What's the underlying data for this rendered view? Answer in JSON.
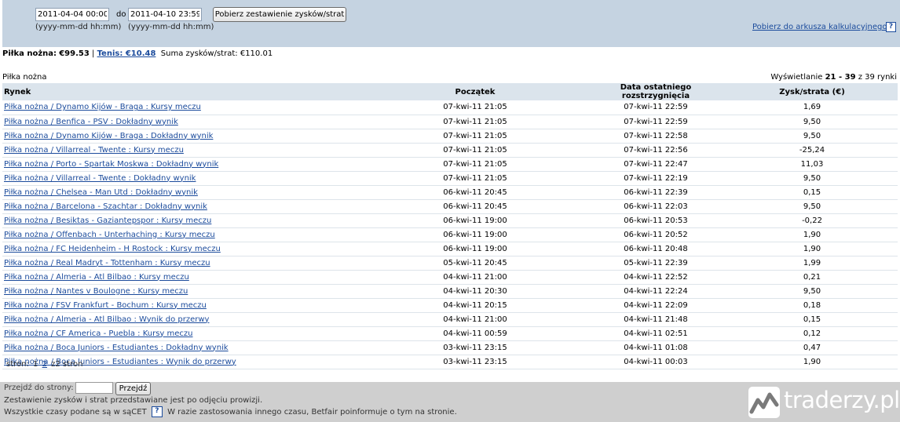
{
  "filter": {
    "date_from": "2011-04-04 00:00",
    "date_to": "2011-04-10 23:59",
    "separator": "do",
    "format_hint": "(yyyy-mm-dd hh:mm)",
    "get_summary_label": "Pobierz zestawienie zysków/strat",
    "spreadsheet_link": "Pobierz do arkusza kalkulacyjnego",
    "help_glyph": "?"
  },
  "totals": {
    "football_label": "Piłka nożna:",
    "football_value": "€99.53",
    "divider": "|",
    "tennis_label": "Tenis: €10.48",
    "sum_label": "Suma zysków/strat:",
    "sum_value": "€110.01"
  },
  "section": {
    "title": "Piłka nożna",
    "paging_prefix": "Wyświetlanie",
    "paging_range": "21 - 39",
    "paging_suffix": "z 39 rynki"
  },
  "table": {
    "headers": {
      "market": "Rynek",
      "start": "Początek",
      "settled": "Data ostatniego rozstrzygnięcia",
      "pl": "Zysk/strata (€)"
    },
    "rows": [
      {
        "market": "Piłka nożna / Dynamo Kijów - Braga : Kursy meczu",
        "start": "07-kwi-11 21:05",
        "settled": "07-kwi-11 22:59",
        "pl": "1,69"
      },
      {
        "market": "Piłka nożna / Benfica - PSV : Dokładny wynik",
        "start": "07-kwi-11 21:05",
        "settled": "07-kwi-11 22:59",
        "pl": "9,50"
      },
      {
        "market": "Piłka nożna / Dynamo Kijów - Braga : Dokładny wynik",
        "start": "07-kwi-11 21:05",
        "settled": "07-kwi-11 22:58",
        "pl": "9,50"
      },
      {
        "market": "Piłka nożna / Villarreal - Twente : Kursy meczu",
        "start": "07-kwi-11 21:05",
        "settled": "07-kwi-11 22:56",
        "pl": "-25,24"
      },
      {
        "market": "Piłka nożna / Porto - Spartak Moskwa : Dokładny wynik",
        "start": "07-kwi-11 21:05",
        "settled": "07-kwi-11 22:47",
        "pl": "11,03"
      },
      {
        "market": "Piłka nożna / Villarreal - Twente : Dokładny wynik",
        "start": "07-kwi-11 21:05",
        "settled": "07-kwi-11 22:19",
        "pl": "9,50"
      },
      {
        "market": "Piłka nożna / Chelsea - Man Utd : Dokładny wynik",
        "start": "06-kwi-11 20:45",
        "settled": "06-kwi-11 22:39",
        "pl": "0,15"
      },
      {
        "market": "Piłka nożna / Barcelona - Szachtar : Dokładny wynik",
        "start": "06-kwi-11 20:45",
        "settled": "06-kwi-11 22:03",
        "pl": "9,50"
      },
      {
        "market": "Piłka nożna / Besiktas - Gaziantepspor : Kursy meczu",
        "start": "06-kwi-11 19:00",
        "settled": "06-kwi-11 20:53",
        "pl": "-0,22"
      },
      {
        "market": "Piłka nożna / Offenbach - Unterhaching : Kursy meczu",
        "start": "06-kwi-11 19:00",
        "settled": "06-kwi-11 20:52",
        "pl": "1,90"
      },
      {
        "market": "Piłka nożna / FC Heidenheim - H Rostock : Kursy meczu",
        "start": "06-kwi-11 19:00",
        "settled": "06-kwi-11 20:48",
        "pl": "1,90"
      },
      {
        "market": "Piłka nożna / Real Madryt - Tottenham : Kursy meczu",
        "start": "05-kwi-11 20:45",
        "settled": "05-kwi-11 22:39",
        "pl": "1,99"
      },
      {
        "market": "Piłka nożna / Almeria - Atl Bilbao : Kursy meczu",
        "start": "04-kwi-11 21:00",
        "settled": "04-kwi-11 22:52",
        "pl": "0,21"
      },
      {
        "market": "Piłka nożna / Nantes v Boulogne : Kursy meczu",
        "start": "04-kwi-11 20:30",
        "settled": "04-kwi-11 22:24",
        "pl": "9,50"
      },
      {
        "market": "Piłka nożna / FSV Frankfurt - Bochum : Kursy meczu",
        "start": "04-kwi-11 20:15",
        "settled": "04-kwi-11 22:09",
        "pl": "0,18"
      },
      {
        "market": "Piłka nożna / Almeria - Atl Bilbao : Wynik do przerwy",
        "start": "04-kwi-11 21:00",
        "settled": "04-kwi-11 21:48",
        "pl": "0,15"
      },
      {
        "market": "Piłka nożna / CF America - Puebla : Kursy meczu",
        "start": "04-kwi-11 00:59",
        "settled": "04-kwi-11 02:51",
        "pl": "0,12"
      },
      {
        "market": "Piłka nożna / Boca Juniors - Estudiantes : Dokładny wynik",
        "start": "03-kwi-11 23:15",
        "settled": "04-kwi-11 01:08",
        "pl": "0,47"
      },
      {
        "market": "Piłka nożna / Boca Juniors - Estudiantes : Wynik do przerwy",
        "start": "03-kwi-11 23:15",
        "settled": "04-kwi-11 00:03",
        "pl": "1,90"
      }
    ]
  },
  "pager": {
    "label": "stron:",
    "current": "1",
    "next": "2",
    "total": "z2 stron"
  },
  "footer": {
    "goto_label": "Przejdź do strony:",
    "goto_button": "Przejdź",
    "note1": "Zestawienie zysków i strat przedstawiane jest po odjęciu prowizji.",
    "note2_a": "Wszystkie czasy podane są w sąCET",
    "note2_b": "W razie zastosowania innego czasu, Betfair poinformuje o tym na stronie."
  },
  "brand": {
    "name": "traderzy.pl",
    "logo_icon": "mountain-chart-icon"
  }
}
